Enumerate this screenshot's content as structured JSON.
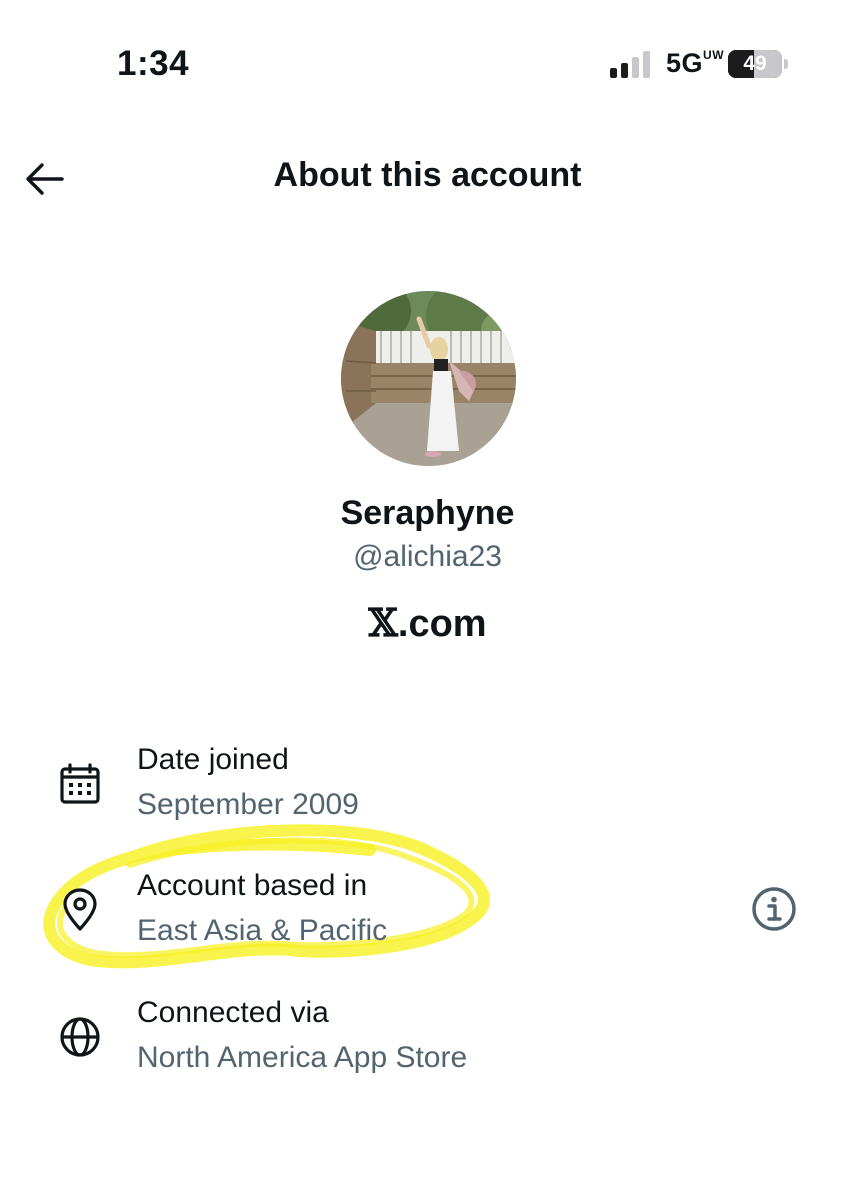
{
  "status_bar": {
    "time": "1:34",
    "network": "5G",
    "network_suffix": "UW",
    "battery": "49",
    "battery_level": 0.49,
    "signal_bars_active": 2,
    "signal_bars_total": 4
  },
  "header": {
    "back_icon": "arrow-left-icon",
    "title": "About this account"
  },
  "profile": {
    "avatar_alt": "profile photo",
    "name": "Seraphyne",
    "handle": "@alichia23",
    "site_glyph": "𝕏",
    "site_rest": ".com"
  },
  "details": [
    {
      "icon": "calendar-icon",
      "label": "Date joined",
      "value": "September 2009"
    },
    {
      "icon": "location-pin-icon",
      "label": "Account based in",
      "value": "East Asia & Pacific",
      "has_info": true,
      "info_icon": "info-circle-icon"
    },
    {
      "icon": "globe-icon",
      "label": "Connected via",
      "value": "North America App Store"
    }
  ],
  "colors": {
    "text_primary": "#0f1419",
    "text_secondary": "#536471",
    "highlight": "#f5f000"
  }
}
